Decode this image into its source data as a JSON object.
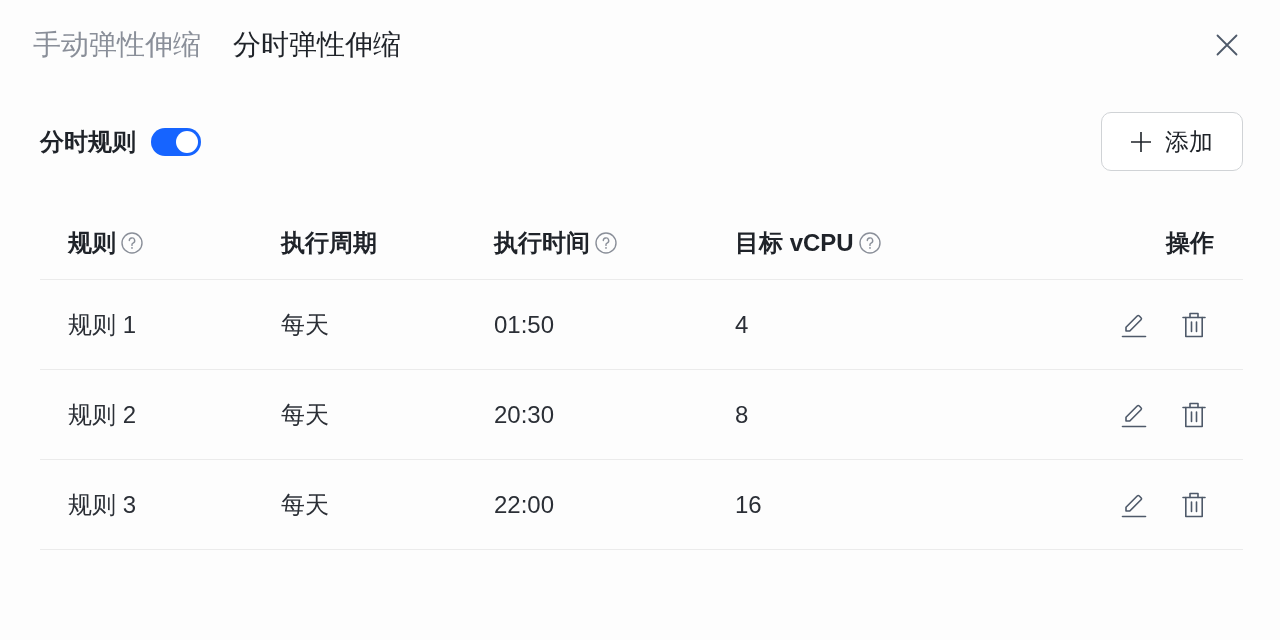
{
  "tabs": [
    {
      "label": "手动弹性伸缩",
      "selected": false
    },
    {
      "label": "分时弹性伸缩",
      "selected": true
    }
  ],
  "rule_toggle": {
    "label": "分时规则",
    "on": true
  },
  "add_button": {
    "label": "添加"
  },
  "table": {
    "columns": [
      {
        "label": "规则",
        "kind": "text",
        "help": true
      },
      {
        "label": "执行周期",
        "kind": "text",
        "help": false
      },
      {
        "label": "执行时间",
        "kind": "text",
        "help": true
      },
      {
        "label": "目标 vCPU",
        "kind": "text",
        "help": true
      },
      {
        "label": "操作",
        "kind": "actions",
        "help": false
      }
    ],
    "rows": [
      {
        "cells": [
          "规则 1",
          "每天",
          "01:50",
          "4"
        ]
      },
      {
        "cells": [
          "规则 2",
          "每天",
          "20:30",
          "8"
        ]
      },
      {
        "cells": [
          "规则 3",
          "每天",
          "22:00",
          "16"
        ]
      }
    ]
  }
}
